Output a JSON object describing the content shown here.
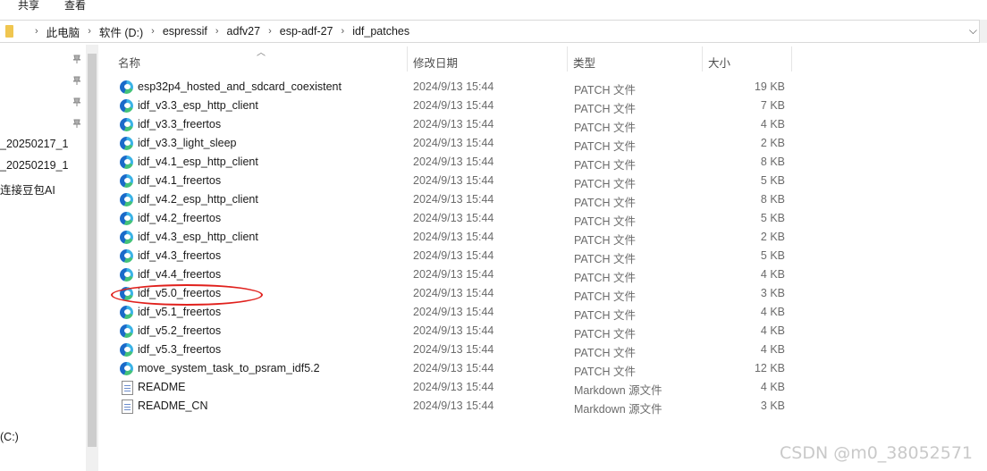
{
  "ribbon": {
    "tabs": [
      "共享",
      "查看"
    ]
  },
  "address": {
    "segments": [
      "此电脑",
      "软件 (D:)",
      "espressif",
      "adfv27",
      "esp-adf-27",
      "idf_patches"
    ]
  },
  "nav": {
    "items": [
      "_20250217_1",
      "_20250219_1",
      "连接豆包AI",
      "(C:)"
    ]
  },
  "columns": {
    "name": "名称",
    "date": "修改日期",
    "type": "类型",
    "size": "大小"
  },
  "files": [
    {
      "name": "esp32p4_hosted_and_sdcard_coexistent",
      "date": "2024/9/13 15:44",
      "type": "PATCH 文件",
      "size": "19 KB",
      "icon": "edge-icon"
    },
    {
      "name": "idf_v3.3_esp_http_client",
      "date": "2024/9/13 15:44",
      "type": "PATCH 文件",
      "size": "7 KB",
      "icon": "edge-icon"
    },
    {
      "name": "idf_v3.3_freertos",
      "date": "2024/9/13 15:44",
      "type": "PATCH 文件",
      "size": "4 KB",
      "icon": "edge-icon"
    },
    {
      "name": "idf_v3.3_light_sleep",
      "date": "2024/9/13 15:44",
      "type": "PATCH 文件",
      "size": "2 KB",
      "icon": "edge-icon"
    },
    {
      "name": "idf_v4.1_esp_http_client",
      "date": "2024/9/13 15:44",
      "type": "PATCH 文件",
      "size": "8 KB",
      "icon": "edge-icon"
    },
    {
      "name": "idf_v4.1_freertos",
      "date": "2024/9/13 15:44",
      "type": "PATCH 文件",
      "size": "5 KB",
      "icon": "edge-icon"
    },
    {
      "name": "idf_v4.2_esp_http_client",
      "date": "2024/9/13 15:44",
      "type": "PATCH 文件",
      "size": "8 KB",
      "icon": "edge-icon"
    },
    {
      "name": "idf_v4.2_freertos",
      "date": "2024/9/13 15:44",
      "type": "PATCH 文件",
      "size": "5 KB",
      "icon": "edge-icon"
    },
    {
      "name": "idf_v4.3_esp_http_client",
      "date": "2024/9/13 15:44",
      "type": "PATCH 文件",
      "size": "2 KB",
      "icon": "edge-icon"
    },
    {
      "name": "idf_v4.3_freertos",
      "date": "2024/9/13 15:44",
      "type": "PATCH 文件",
      "size": "5 KB",
      "icon": "edge-icon"
    },
    {
      "name": "idf_v4.4_freertos",
      "date": "2024/9/13 15:44",
      "type": "PATCH 文件",
      "size": "4 KB",
      "icon": "edge-icon"
    },
    {
      "name": "idf_v5.0_freertos",
      "date": "2024/9/13 15:44",
      "type": "PATCH 文件",
      "size": "3 KB",
      "icon": "edge-icon"
    },
    {
      "name": "idf_v5.1_freertos",
      "date": "2024/9/13 15:44",
      "type": "PATCH 文件",
      "size": "4 KB",
      "icon": "edge-icon"
    },
    {
      "name": "idf_v5.2_freertos",
      "date": "2024/9/13 15:44",
      "type": "PATCH 文件",
      "size": "4 KB",
      "icon": "edge-icon"
    },
    {
      "name": "idf_v5.3_freertos",
      "date": "2024/9/13 15:44",
      "type": "PATCH 文件",
      "size": "4 KB",
      "icon": "edge-icon"
    },
    {
      "name": "move_system_task_to_psram_idf5.2",
      "date": "2024/9/13 15:44",
      "type": "PATCH 文件",
      "size": "12 KB",
      "icon": "edge-icon"
    },
    {
      "name": "README",
      "date": "2024/9/13 15:44",
      "type": "Markdown 源文件",
      "size": "4 KB",
      "icon": "markdown-file-icon"
    },
    {
      "name": "README_CN",
      "date": "2024/9/13 15:44",
      "type": "Markdown 源文件",
      "size": "3 KB",
      "icon": "markdown-file-icon"
    }
  ],
  "annotation": {
    "highlighted_file": "idf_v5.0_freertos",
    "color": "#e0201c"
  },
  "watermark": "CSDN @m0_38052571"
}
